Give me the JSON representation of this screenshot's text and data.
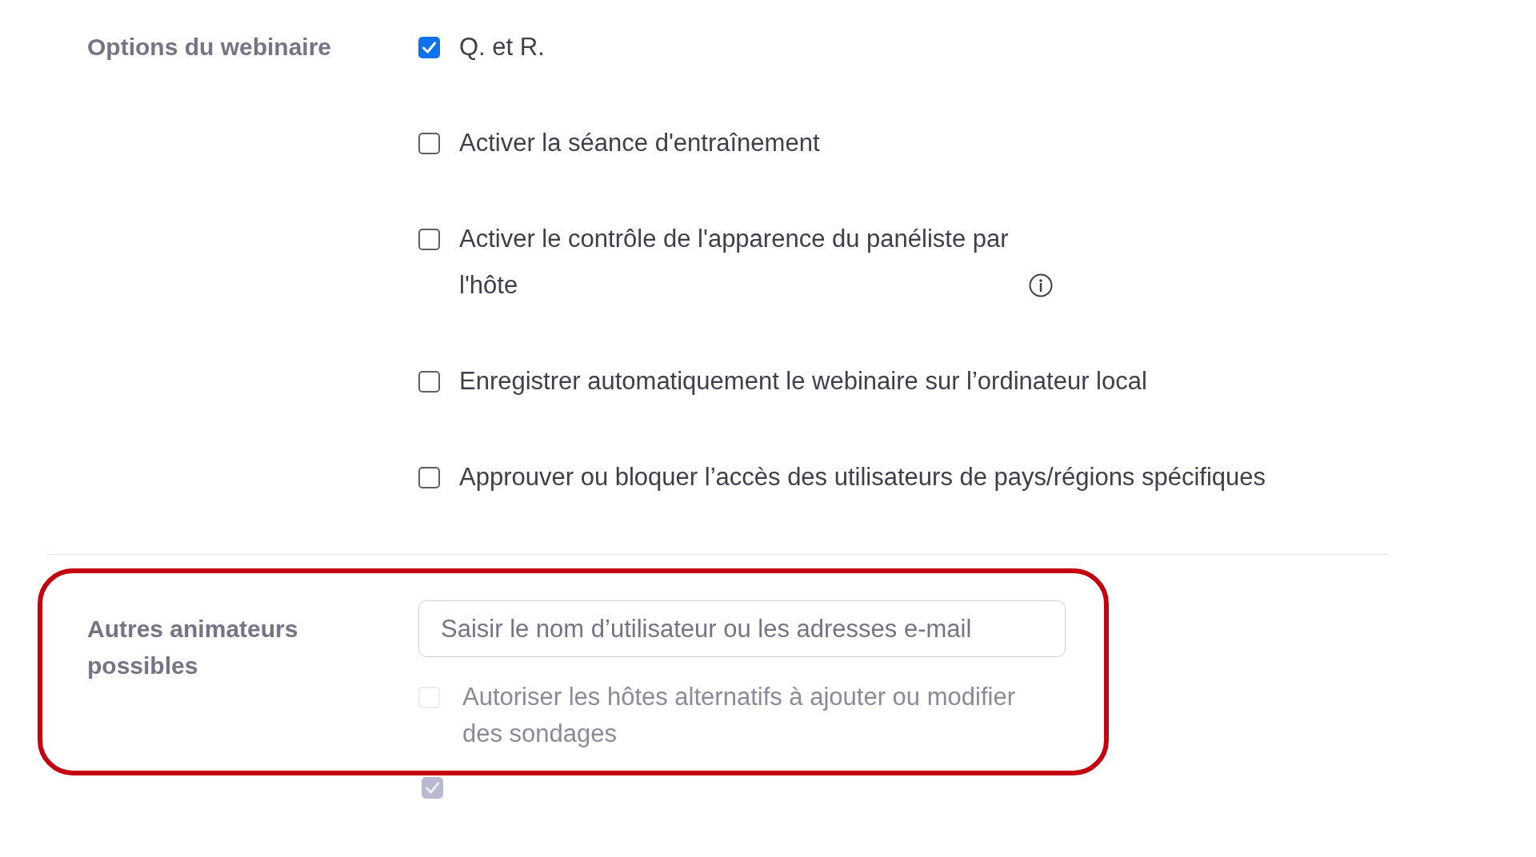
{
  "webinar_options": {
    "label": "Options du webinaire",
    "options": [
      {
        "label": "Q. et R.",
        "checked": true,
        "info_icon": false
      },
      {
        "label": "Activer la séance d'entraînement",
        "checked": false,
        "info_icon": false
      },
      {
        "label": "Activer le contrôle de l'apparence du panéliste par l'hôte",
        "checked": false,
        "info_icon": true
      },
      {
        "label": "Enregistrer automatiquement le webinaire sur l’ordinateur local",
        "checked": false,
        "info_icon": false
      },
      {
        "label": "Approuver ou bloquer l’accès des utilisateurs de pays/régions spécifiques",
        "checked": false,
        "info_icon": false
      }
    ]
  },
  "alternative_hosts": {
    "highlighted": true,
    "label": "Autres animateurs possibles",
    "field": {
      "placeholder": "Saisir le nom d’utilisateur ou les adresses e-mail"
    },
    "option": {
      "label": "Autoriser les hôtes alternatifs à ajouter ou modifier des sondages",
      "checked": false,
      "disabled": true
    }
  },
  "partial_checkbox": {
    "checked": true,
    "disabled": true
  }
}
